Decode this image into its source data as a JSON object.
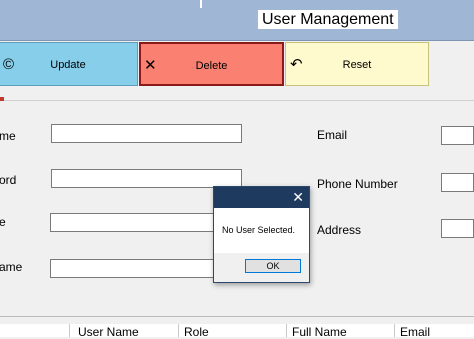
{
  "header": {
    "title": "User Management"
  },
  "toolbar": {
    "update_label": "Update",
    "update_icon": "©",
    "delete_label": "Delete",
    "delete_icon": "✕",
    "reset_label": "Reset",
    "reset_icon": "↶"
  },
  "form": {
    "left_labels": [
      "me",
      "ord",
      "e",
      "ame"
    ],
    "right_labels": [
      "Email",
      "Phone Number",
      "Address"
    ]
  },
  "grid": {
    "columns": [
      "User Name",
      "Role",
      "Full Name",
      "Email"
    ]
  },
  "dialog": {
    "close_icon": "✕",
    "message": "No User Selected.",
    "ok_label": "OK"
  },
  "colors": {
    "title_bar": "#9fb6d4",
    "update": "#87ceeb",
    "delete": "#fa8072",
    "reset": "#fffacd",
    "dialog_title": "#1f3a5f",
    "ok_border": "#0078d7"
  }
}
